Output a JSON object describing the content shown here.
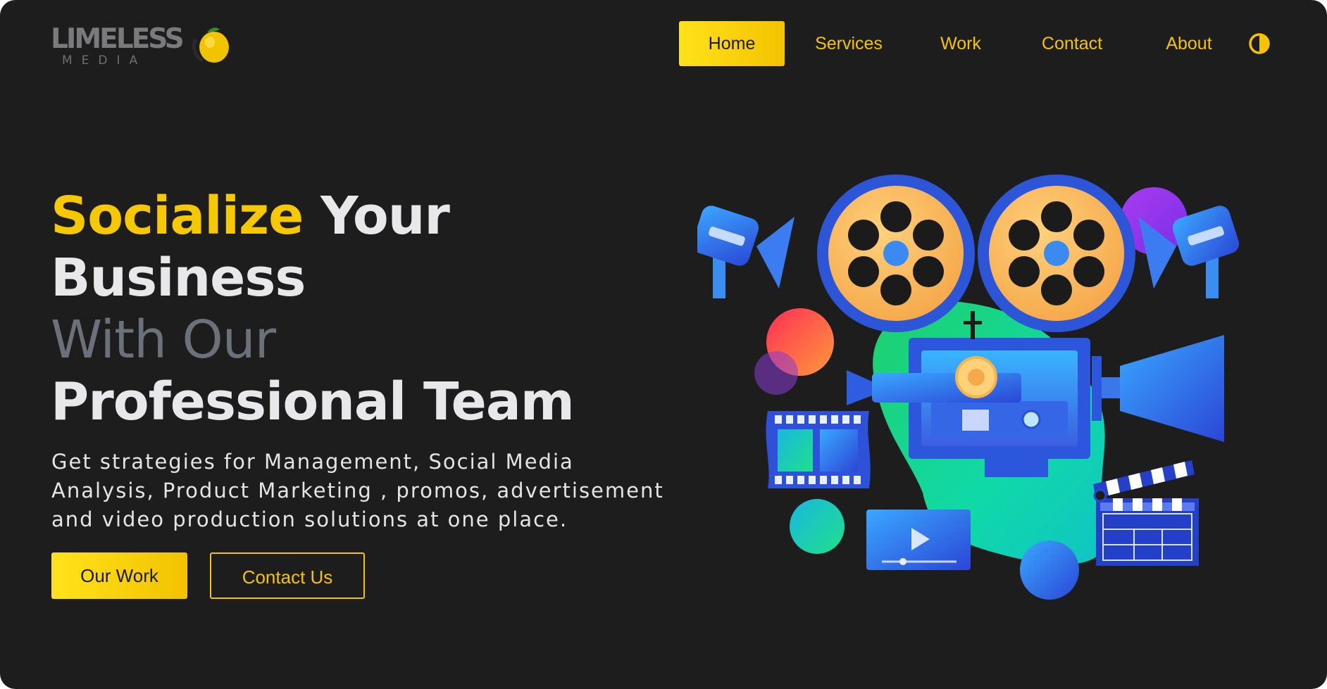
{
  "brand": {
    "logo_word": "LIMELESS",
    "logo_sub": "MEDIA"
  },
  "nav": {
    "items": [
      {
        "label": "Home",
        "active": true
      },
      {
        "label": "Services",
        "active": false
      },
      {
        "label": "Work",
        "active": false
      },
      {
        "label": "Contact",
        "active": false
      },
      {
        "label": "About",
        "active": false
      }
    ],
    "theme_icon": "contrast-half-circle-icon"
  },
  "hero": {
    "line1_highlight": "Socialize",
    "line1_rest": "Your",
    "line2": "Business",
    "line3": "With Our",
    "line4": "Professional Team",
    "description_lines": [
      "Get strategies for Management, Social Media",
      "Analysis, Product Marketing , promos, advertisement",
      "and video production solutions at one place."
    ],
    "primary_button": "Our Work",
    "secondary_button": "Contact Us"
  },
  "colors": {
    "background": "#1d1d1e",
    "accent": "#f5c400",
    "heading_white": "#e8e8ea",
    "heading_gray": "#6b7079"
  },
  "illustration": {
    "icons": [
      "film-reel-icon",
      "movie-camera-icon",
      "spotlight-icon",
      "film-strip-icon",
      "video-player-icon",
      "clapperboard-icon"
    ]
  }
}
